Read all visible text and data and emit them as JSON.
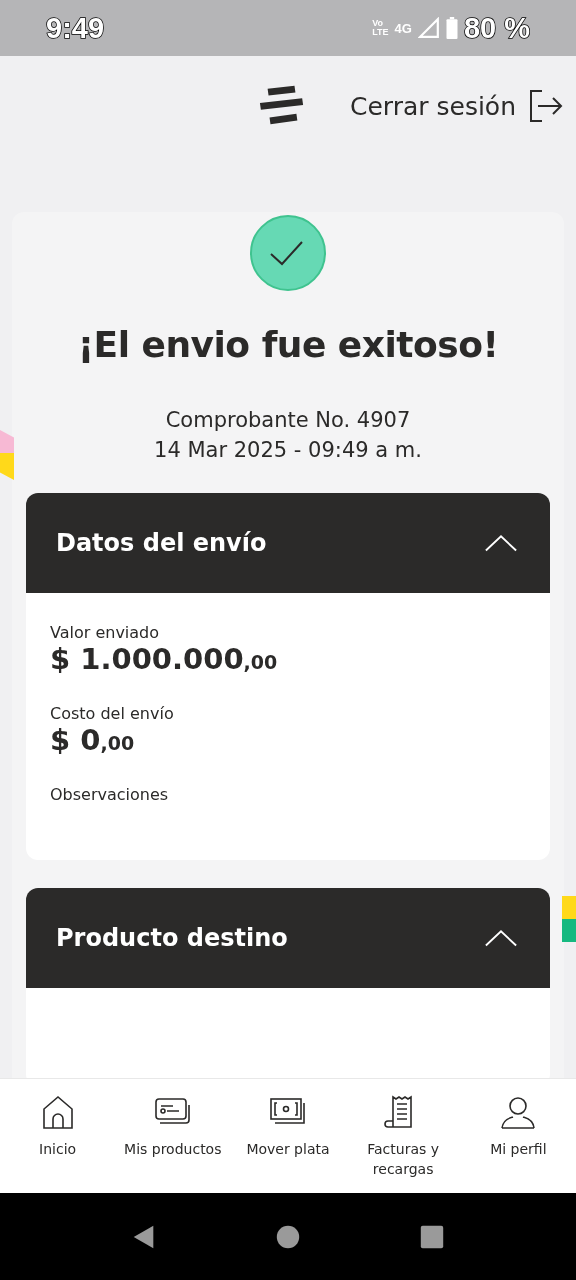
{
  "status_bar": {
    "time": "9:49",
    "volte_top": "Vo",
    "volte_bottom": "LTE",
    "network": "4G",
    "battery": "80 %"
  },
  "header": {
    "logout": "Cerrar sesión"
  },
  "result": {
    "title": "¡El envio fue exitoso!",
    "receipt": "Comprobante No. 4907",
    "date": "14 Mar 2025 - 09:49 a m."
  },
  "sections": [
    {
      "title": "Datos del envío",
      "expanded": true,
      "fields": [
        {
          "label": "Valor enviado",
          "amount": "$ 1.000.000",
          "cents": ",00"
        },
        {
          "label": "Costo del envío",
          "amount": "$ 0",
          "cents": ",00"
        },
        {
          "label": "Observaciones"
        }
      ]
    },
    {
      "title": "Producto destino",
      "expanded": true
    }
  ],
  "bottom_nav": [
    {
      "label": "Inicio",
      "selected": false
    },
    {
      "label": "Mis productos",
      "selected": false
    },
    {
      "label": "Mover plata",
      "selected": false
    },
    {
      "label": "Facturas y recargas",
      "selected": false
    },
    {
      "label": "Mi perfil",
      "selected": false
    }
  ]
}
